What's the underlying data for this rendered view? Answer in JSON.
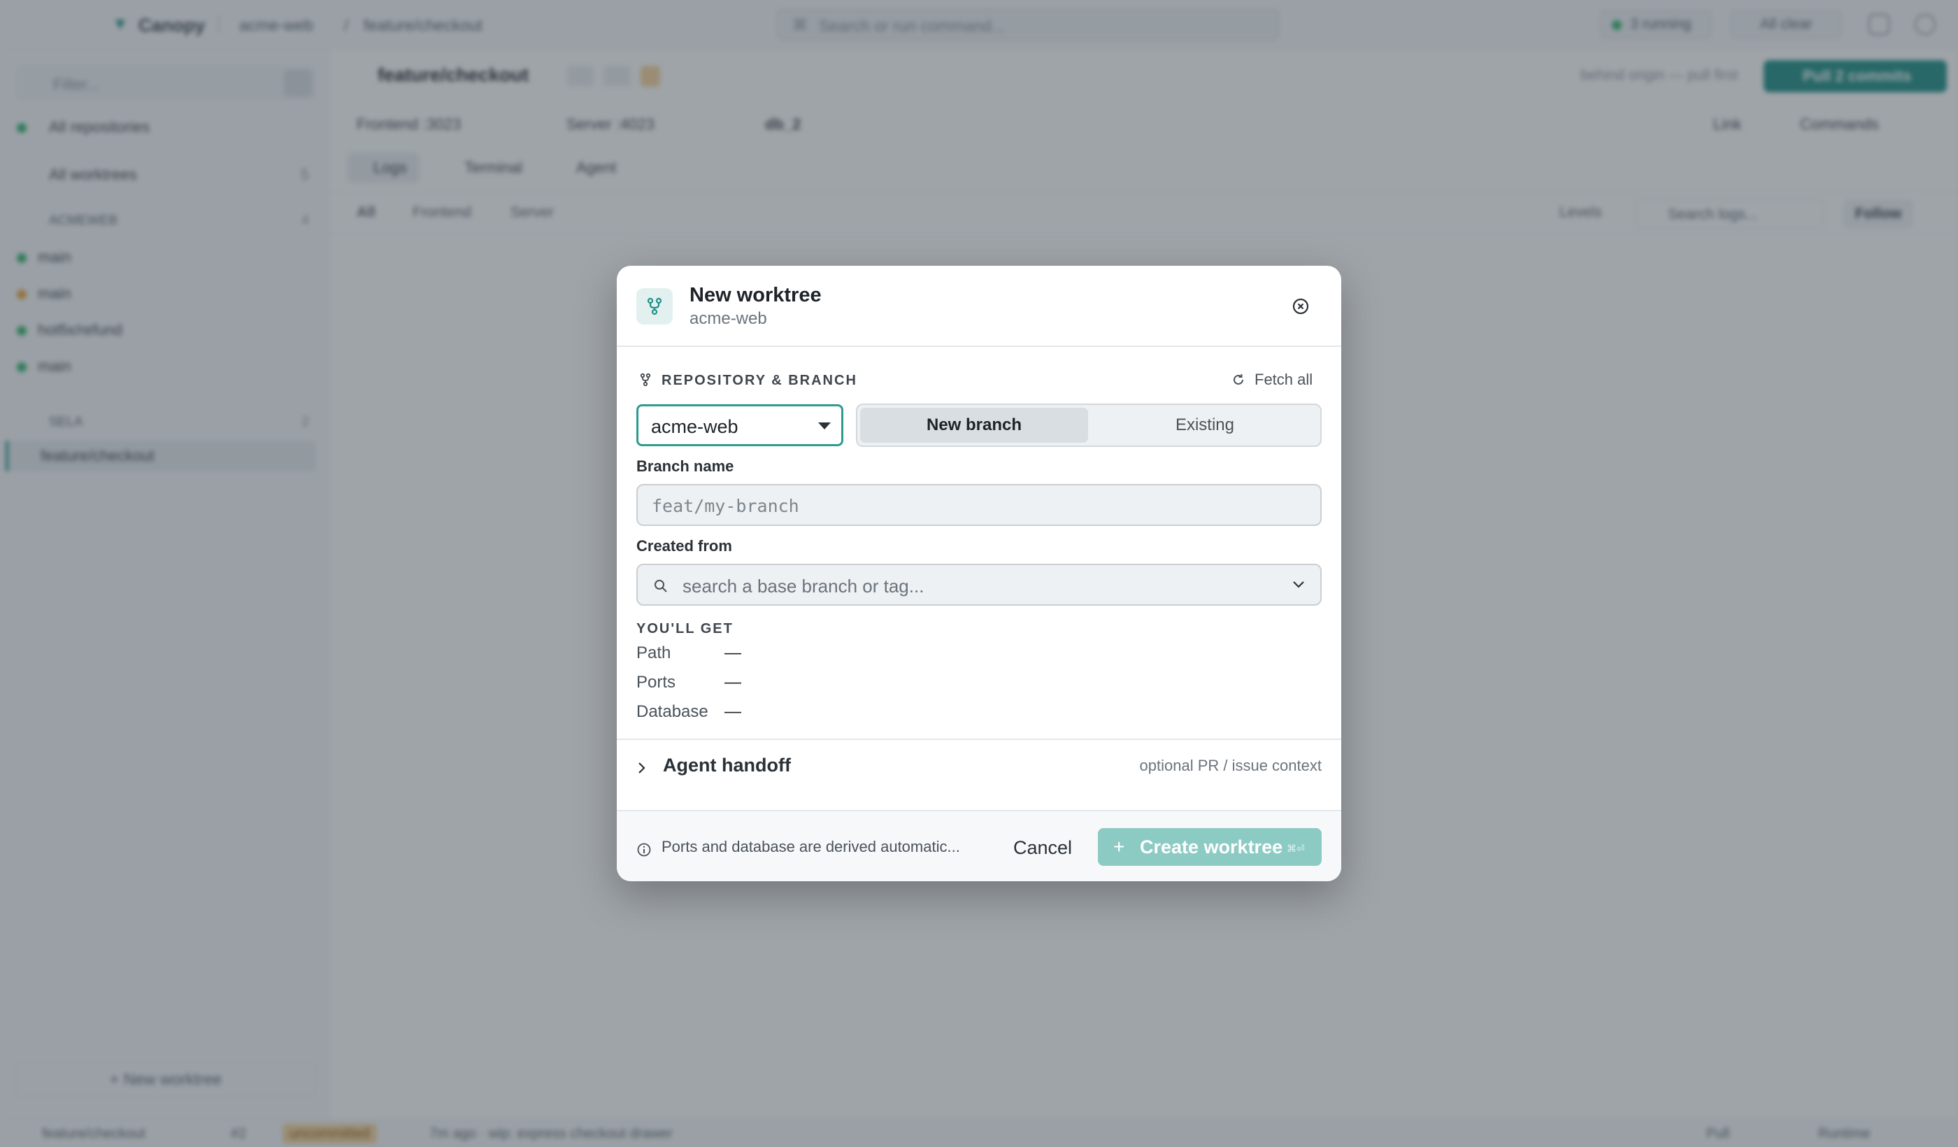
{
  "app": {
    "name": "Canopy",
    "breadcrumb": [
      "acme-web",
      "feature/checkout"
    ],
    "search_placeholder": "Search or run command...",
    "running_label": "3 running",
    "all_clear_label": "All clear"
  },
  "sidebar": {
    "filter_placeholder": "Filter...",
    "all_repositories": "All repositories",
    "all_worktrees": "All worktrees",
    "all_worktrees_count": "5",
    "groups": [
      {
        "label": "ACMEWEB",
        "count": "4"
      },
      {
        "label": "SELA",
        "count": "2"
      }
    ],
    "items": [
      {
        "label": "main",
        "dot": "#2db36b"
      },
      {
        "label": "main",
        "dot": "#e8a23a"
      },
      {
        "label": "hotfix/refund",
        "dot": "#2db36b"
      },
      {
        "label": "main",
        "dot": "#2db36b"
      },
      {
        "label": "feature/checkout",
        "dot": "#e8a23a"
      }
    ],
    "new_worktree": "New worktree"
  },
  "main": {
    "title": "feature/checkout",
    "ahead_behind": "behind origin — pull first",
    "pull_label": "Pull 2 commits",
    "services": [
      "Frontend :3023",
      "Server :4023",
      "db_2"
    ],
    "link_label": "Link",
    "commands_label": "Commands",
    "tabs": [
      "Logs",
      "Terminal",
      "Agent"
    ],
    "filters": [
      "All",
      "Frontend",
      "Server"
    ],
    "levels_label": "Levels",
    "search_logs": "Search logs...",
    "follow_label": "Follow"
  },
  "statusbar": {
    "branch": "feature/checkout",
    "pr": "#2",
    "uncommitted": "uncommitted",
    "last_commit": "7m ago · wip: express checkout drawer",
    "pull": "Pull",
    "runtime": "Runtime"
  },
  "modal": {
    "title": "New worktree",
    "subtitle": "acme-web",
    "section_label": "REPOSITORY & BRANCH",
    "fetch_all": "Fetch all",
    "repo_value": "acme-web",
    "mode_new": "New branch",
    "mode_existing": "Existing",
    "branch_label": "Branch name",
    "branch_placeholder": "feat/my-branch",
    "created_from_label": "Created from",
    "created_from_placeholder": "search a base branch or tag...",
    "youll_get_label": "YOU'LL GET",
    "youll_get": [
      {
        "key": "Path",
        "value": "—"
      },
      {
        "key": "Ports",
        "value": "—"
      },
      {
        "key": "Database",
        "value": "—"
      }
    ],
    "handoff_label": "Agent handoff",
    "handoff_hint": "optional PR / issue context",
    "footer_info": "Ports and database are derived automatic...",
    "cancel": "Cancel",
    "create": "Create worktree",
    "create_shortcut": "⌘⏎"
  },
  "colors": {
    "accent": "#1f8f86",
    "create_button": "#8ccbc4",
    "overlay": "#37404c"
  }
}
